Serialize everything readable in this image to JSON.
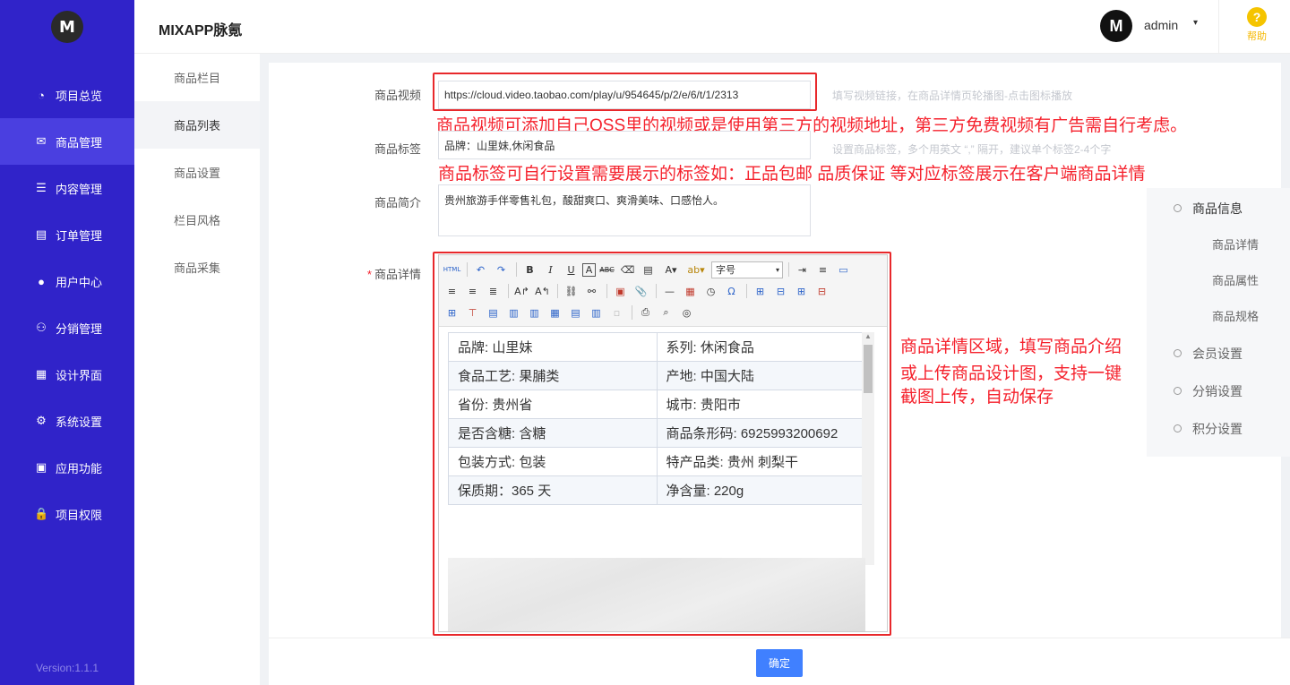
{
  "sidebar": {
    "logo_text": "M",
    "items": [
      {
        "label": "项目总览",
        "icon": "pie-chart-icon",
        "glyph": "◔"
      },
      {
        "label": "商品管理",
        "icon": "mail-icon",
        "glyph": "✉"
      },
      {
        "label": "内容管理",
        "icon": "list-icon",
        "glyph": "☰"
      },
      {
        "label": "订单管理",
        "icon": "document-icon",
        "glyph": "▤"
      },
      {
        "label": "用户中心",
        "icon": "user-icon",
        "glyph": "●"
      },
      {
        "label": "分销管理",
        "icon": "users-icon",
        "glyph": "⚇"
      },
      {
        "label": "设计界面",
        "icon": "layout-icon",
        "glyph": "▦"
      },
      {
        "label": "系统设置",
        "icon": "gear-icon",
        "glyph": "⚙"
      },
      {
        "label": "应用功能",
        "icon": "grid-icon",
        "glyph": "▣"
      },
      {
        "label": "项目权限",
        "icon": "lock-icon",
        "glyph": "🔒"
      }
    ],
    "version": "Version:1.1.1"
  },
  "subnav": {
    "items": [
      "商品栏目",
      "商品列表",
      "商品设置",
      "栏目风格",
      "商品采集"
    ]
  },
  "header": {
    "title": "MIXAPP脉氪",
    "avatar_text": "M",
    "user": "admin",
    "caret": "▾",
    "help_glyph": "?",
    "help_label": "帮助"
  },
  "form": {
    "video_label": "商品视频",
    "video_value": "https://cloud.video.taobao.com/play/u/954645/p/2/e/6/t/1/2313",
    "video_hint": "填写视频链接，在商品详情页轮播图-点击图标播放",
    "video_note": "商品视频可添加自己OSS里的视频或是使用第三方的视频地址，第三方免费视频有广告需自行考虑。",
    "tag_label": "商品标签",
    "tag_value": "品牌：山里妹,休闲食品",
    "tag_hint": "设置商品标签，多个用英文 “,” 隔开，建议单个标签2-4个字",
    "tag_note": "商品标签可自行设置需要展示的标签如：正品包邮  品质保证  等对应标签展示在客户端商品详情",
    "intro_label": "商品简介",
    "intro_value": "贵州旅游手伴零售礼包，酸甜爽口、爽滑美味、口感怡人。",
    "required_mark": "*",
    "detail_label": "商品详情",
    "detail_note_1": "商品详情区域，填写商品介绍",
    "detail_note_2": "或上传商品设计图，支持一键",
    "detail_note_3": "截图上传，自动保存"
  },
  "editor": {
    "fontsize_placeholder": "字号",
    "spec_rows": [
      [
        "品牌: 山里妹",
        "系列: 休闲食品"
      ],
      [
        "食品工艺: 果脯类",
        "产地: 中国大陆"
      ],
      [
        "省份: 贵州省",
        "城市: 贵阳市"
      ],
      [
        "是否含糖: 含糖",
        "商品条形码: 6925993200692"
      ],
      [
        "包装方式: 包装",
        "特产品类: 贵州 刺梨干"
      ],
      [
        "保质期：365 天",
        "净含量: 220g"
      ]
    ]
  },
  "anchor": {
    "items": [
      "商品信息",
      "商品详情",
      "商品属性",
      "商品规格",
      "会员设置",
      "分销设置",
      "积分设置"
    ]
  },
  "footer": {
    "confirm_label": "确定"
  }
}
